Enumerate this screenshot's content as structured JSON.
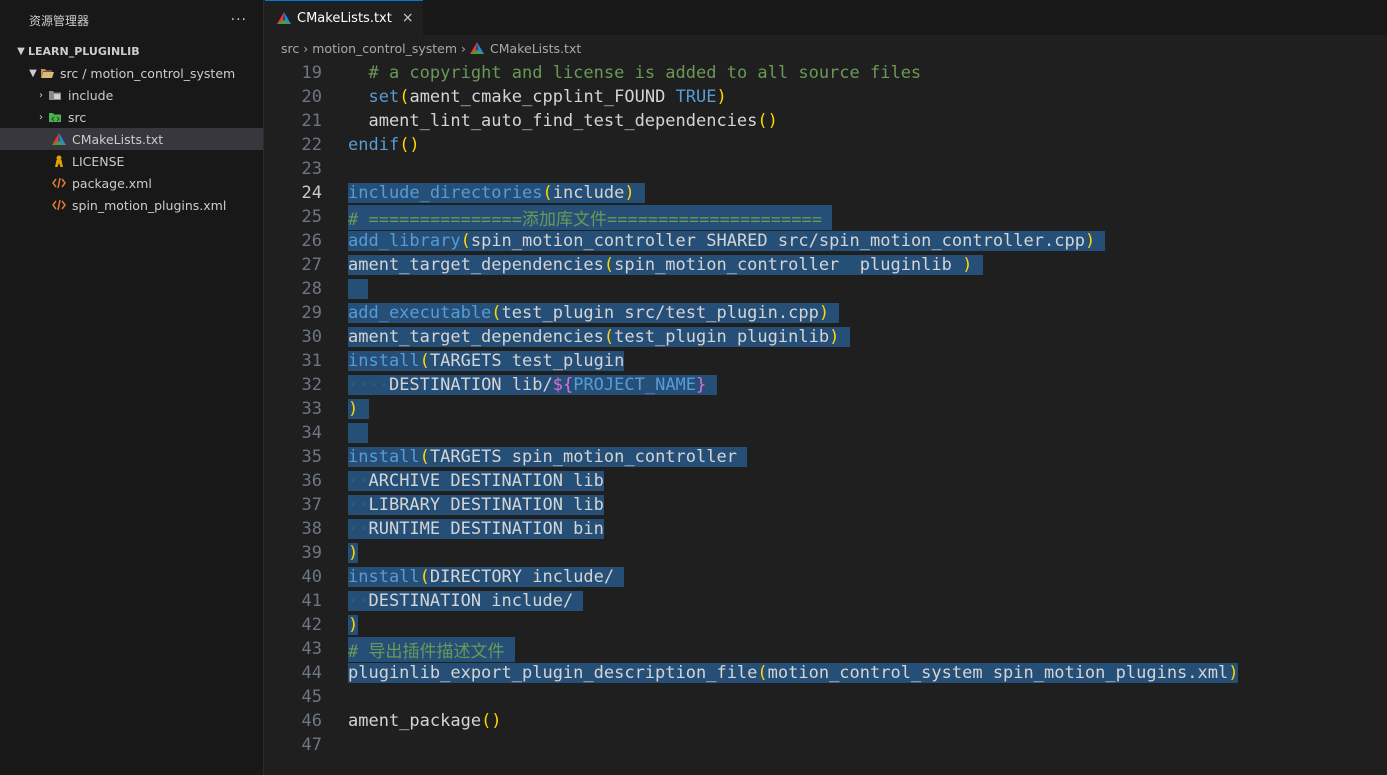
{
  "explorer": {
    "title": "资源管理器",
    "more": "···",
    "root": "LEARN_PLUGINLIB",
    "items": [
      {
        "label": "src / motion_control_system",
        "kind": "folder-open"
      },
      {
        "label": "include",
        "kind": "folder"
      },
      {
        "label": "src",
        "kind": "folder"
      },
      {
        "label": "CMakeLists.txt",
        "kind": "cmake"
      },
      {
        "label": "LICENSE",
        "kind": "license"
      },
      {
        "label": "package.xml",
        "kind": "xml"
      },
      {
        "label": "spin_motion_plugins.xml",
        "kind": "xml"
      }
    ]
  },
  "tab": {
    "label": "CMakeLists.txt",
    "close": "×"
  },
  "breadcrumb": {
    "part1": "src",
    "part2": "motion_control_system",
    "part3": "CMakeLists.txt",
    "sep": "›"
  },
  "colors": {
    "accent": "#0078d4",
    "selection": "#264f78",
    "keyword": "#569cd6",
    "comment": "#6a9955",
    "bracket": "#ffd700"
  },
  "code": {
    "active_line": 24,
    "lines": [
      {
        "n": 19,
        "sel": false,
        "tokens": [
          [
            "n",
            "  "
          ],
          [
            "c",
            "# a copyright and license is added to all source files"
          ]
        ]
      },
      {
        "n": 20,
        "sel": false,
        "tokens": [
          [
            "n",
            "  "
          ],
          [
            "k",
            "set"
          ],
          [
            "p",
            "("
          ],
          [
            "n",
            "ament_cmake_cpplint_FOUND "
          ],
          [
            "k",
            "TRUE"
          ],
          [
            "p",
            ")"
          ]
        ]
      },
      {
        "n": 21,
        "sel": false,
        "tokens": [
          [
            "n",
            "  ament_lint_auto_find_test_dependencies"
          ],
          [
            "p",
            "()"
          ]
        ]
      },
      {
        "n": 22,
        "sel": false,
        "tokens": [
          [
            "k",
            "endif"
          ],
          [
            "p",
            "()"
          ]
        ]
      },
      {
        "n": 23,
        "sel": false,
        "tokens": []
      },
      {
        "n": 24,
        "sel": true,
        "tokens": [
          [
            "k",
            "include_directories"
          ],
          [
            "p",
            "("
          ],
          [
            "n",
            "include"
          ],
          [
            "p",
            ")"
          ],
          [
            "n",
            " "
          ]
        ]
      },
      {
        "n": 25,
        "sel": true,
        "tokens": [
          [
            "c",
            "# ===============添加库文件====================="
          ],
          [
            "n",
            " "
          ]
        ]
      },
      {
        "n": 26,
        "sel": true,
        "tokens": [
          [
            "k",
            "add_library"
          ],
          [
            "p",
            "("
          ],
          [
            "n",
            "spin_motion_controller SHARED src/spin_motion_controller.cpp"
          ],
          [
            "p",
            ")"
          ],
          [
            "n",
            " "
          ]
        ]
      },
      {
        "n": 27,
        "sel": true,
        "tokens": [
          [
            "n",
            "ament_target_dependencies"
          ],
          [
            "p",
            "("
          ],
          [
            "n",
            "spin_motion_controller  pluginlib "
          ],
          [
            "p",
            ")"
          ],
          [
            "n",
            " "
          ]
        ]
      },
      {
        "n": 28,
        "sel": true,
        "tokens": [
          [
            "n",
            "  "
          ]
        ]
      },
      {
        "n": 29,
        "sel": true,
        "tokens": [
          [
            "k",
            "add_executable"
          ],
          [
            "p",
            "("
          ],
          [
            "n",
            "test_plugin src/test_plugin.cpp"
          ],
          [
            "p",
            ")"
          ],
          [
            "n",
            " "
          ]
        ]
      },
      {
        "n": 30,
        "sel": true,
        "tokens": [
          [
            "n",
            "ament_target_dependencies"
          ],
          [
            "p",
            "("
          ],
          [
            "n",
            "test_plugin pluginlib"
          ],
          [
            "p",
            ")"
          ],
          [
            "n",
            " "
          ]
        ]
      },
      {
        "n": 31,
        "sel": true,
        "tokens": [
          [
            "k",
            "install"
          ],
          [
            "p",
            "("
          ],
          [
            "n",
            "TARGETS test_plugin"
          ]
        ]
      },
      {
        "n": 32,
        "sel": true,
        "tokens": [
          [
            "ws",
            "····"
          ],
          [
            "n",
            "DESTINATION lib/"
          ],
          [
            "vp",
            "${"
          ],
          [
            "v",
            "PROJECT_NAME"
          ],
          [
            "vp",
            "}"
          ],
          [
            "n",
            " "
          ]
        ]
      },
      {
        "n": 33,
        "sel": true,
        "tokens": [
          [
            "p",
            ")"
          ],
          [
            "n",
            " "
          ]
        ]
      },
      {
        "n": 34,
        "sel": true,
        "tokens": [
          [
            "n",
            "  "
          ]
        ]
      },
      {
        "n": 35,
        "sel": true,
        "tokens": [
          [
            "k",
            "install"
          ],
          [
            "p",
            "("
          ],
          [
            "n",
            "TARGETS spin_motion_controller "
          ]
        ]
      },
      {
        "n": 36,
        "sel": true,
        "tokens": [
          [
            "ws",
            "··"
          ],
          [
            "n",
            "ARCHIVE DESTINATION lib"
          ]
        ]
      },
      {
        "n": 37,
        "sel": true,
        "tokens": [
          [
            "ws",
            "··"
          ],
          [
            "n",
            "LIBRARY DESTINATION lib"
          ]
        ]
      },
      {
        "n": 38,
        "sel": true,
        "tokens": [
          [
            "ws",
            "··"
          ],
          [
            "n",
            "RUNTIME DESTINATION bin"
          ]
        ]
      },
      {
        "n": 39,
        "sel": true,
        "tokens": [
          [
            "p",
            ")"
          ]
        ]
      },
      {
        "n": 40,
        "sel": true,
        "tokens": [
          [
            "k",
            "install"
          ],
          [
            "p",
            "("
          ],
          [
            "n",
            "DIRECTORY include/ "
          ]
        ]
      },
      {
        "n": 41,
        "sel": true,
        "tokens": [
          [
            "ws",
            "··"
          ],
          [
            "n",
            "DESTINATION include/ "
          ]
        ]
      },
      {
        "n": 42,
        "sel": true,
        "tokens": [
          [
            "p",
            ")"
          ]
        ]
      },
      {
        "n": 43,
        "sel": true,
        "tokens": [
          [
            "c",
            "# 导出插件描述文件"
          ],
          [
            "n",
            " "
          ]
        ]
      },
      {
        "n": 44,
        "sel": true,
        "tokens": [
          [
            "n",
            "pluginlib_export_plugin_description_file"
          ],
          [
            "p",
            "("
          ],
          [
            "n",
            "motion_control_system spin_motion_plugins.xml"
          ],
          [
            "p",
            ")"
          ]
        ]
      },
      {
        "n": 45,
        "sel": false,
        "tokens": []
      },
      {
        "n": 46,
        "sel": false,
        "tokens": [
          [
            "n",
            "ament_package"
          ],
          [
            "p",
            "()"
          ]
        ]
      },
      {
        "n": 47,
        "sel": false,
        "tokens": []
      }
    ]
  }
}
